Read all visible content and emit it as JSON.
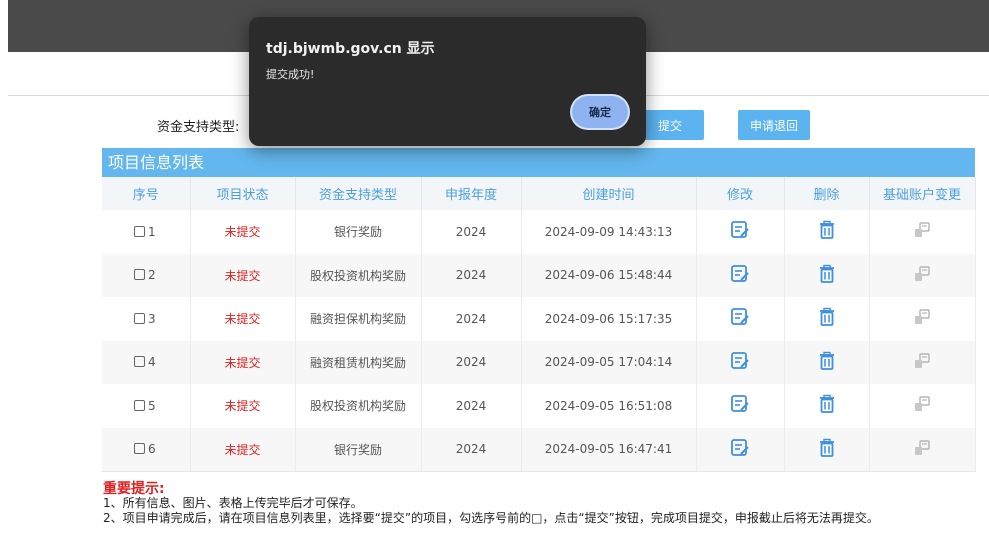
{
  "filter": {
    "label": "资金支持类型:"
  },
  "toolbar": {
    "submit_label": "提交",
    "withdraw_label": "申请退回"
  },
  "table": {
    "title": "项目信息列表",
    "columns": [
      "序号",
      "项目状态",
      "资金支持类型",
      "申报年度",
      "创建时间",
      "修改",
      "删除",
      "基础账户变更"
    ],
    "rows": [
      {
        "seq": "1",
        "status": "未提交",
        "type": "银行奖励",
        "year": "2024",
        "created": "2024-09-09 14:43:13"
      },
      {
        "seq": "2",
        "status": "未提交",
        "type": "股权投资机构奖励",
        "year": "2024",
        "created": "2024-09-06 15:48:44"
      },
      {
        "seq": "3",
        "status": "未提交",
        "type": "融资担保机构奖励",
        "year": "2024",
        "created": "2024-09-06 15:17:35"
      },
      {
        "seq": "4",
        "status": "未提交",
        "type": "融资租赁机构奖励",
        "year": "2024",
        "created": "2024-09-05 17:04:14"
      },
      {
        "seq": "5",
        "status": "未提交",
        "type": "股权投资机构奖励",
        "year": "2024",
        "created": "2024-09-05 16:51:08"
      },
      {
        "seq": "6",
        "status": "未提交",
        "type": "银行奖励",
        "year": "2024",
        "created": "2024-09-05 16:47:41"
      }
    ]
  },
  "notes": {
    "title": "重要提示:",
    "items": [
      "1、所有信息、图片、表格上传完毕后才可保存。",
      "2、项目申请完成后，请在项目信息列表里，选择要“提交”的项目，勾选序号前的□，点击“提交”按钮，完成项目提交，申报截止后将无法再提交。"
    ]
  },
  "dialog": {
    "host": "tdj.bjwmb.gov.cn 显示",
    "message": "提交成功!",
    "ok_label": "确定"
  },
  "colors": {
    "accent": "#63b7ee",
    "header_text": "#4a9fe0",
    "status_red": "#e02020",
    "dialog_bg": "#2b2b2b",
    "dialog_button": "#8fb2f0"
  },
  "icons": {
    "edit": "edit-icon",
    "delete": "trash-icon",
    "account_change": "account-change-icon"
  }
}
